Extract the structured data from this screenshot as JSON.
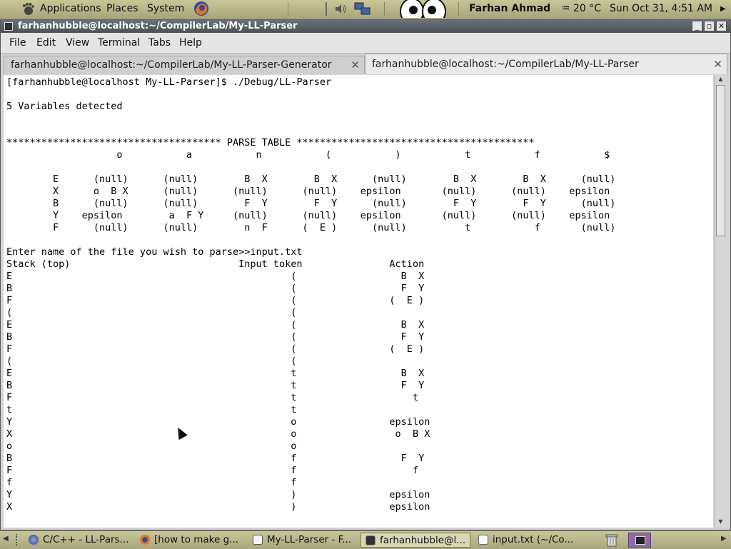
{
  "top_panel": {
    "applications": "Applications",
    "places": "Places",
    "system": "System",
    "user": "Farhan Ahmad",
    "weather": "20 °C",
    "datetime": "Sun Oct 31,  4:51 AM"
  },
  "window": {
    "title": "farhanhubble@localhost:~/CompilerLab/My-LL-Parser",
    "menu": [
      "File",
      "Edit",
      "View",
      "Terminal",
      "Tabs",
      "Help"
    ],
    "tabs": [
      {
        "label": "farhanhubble@localhost:~/CompilerLab/My-LL-Parser-Generator"
      },
      {
        "label": "farhanhubble@localhost:~/CompilerLab/My-LL-Parser"
      }
    ]
  },
  "terminal": {
    "text": "[farhanhubble@localhost My-LL-Parser]$ ./Debug/LL-Parser\n\n5 Variables detected\n\n\n************************************* PARSE TABLE *****************************************\n                   o           a           n           (           )           t           f           $\n\n        E      (null)      (null)        B  X        B  X      (null)        B  X        B  X      (null)\n        X      o  B X      (null)      (null)      (null)    epsilon       (null)      (null)    epsilon\n        B      (null)      (null)        F  Y        F  Y      (null)        F  Y        F  Y      (null)\n        Y    epsilon        a  F Y     (null)      (null)    epsilon       (null)      (null)    epsilon\n        F      (null)      (null)        n  F      (  E )      (null)          t           f       (null)\n\nEnter name of the file you wish to parse>>input.txt\nStack (top)                             Input token               Action\nE                                                (                  B  X\nB                                                (                  F  Y\nF                                                (                (  E )\n(                                                (\nE                                                (                  B  X\nB                                                (                  F  Y\nF                                                (                (  E )\n(                                                (\nE                                                t                  B  X\nB                                                t                  F  Y\nF                                                t                    t\nt                                                t\nY                                                o                epsilon\nX                                                o                 o  B X\no                                                o\nB                                                f                  F  Y\nF                                                f                    f\nf                                                f\nY                                                )                epsilon\nX                                                )                epsilon"
  },
  "taskbar": [
    {
      "label": "C/C++ - LL-Pars...",
      "icon": "eclipse-icon"
    },
    {
      "label": "[how to make g...",
      "icon": "firefox-icon"
    },
    {
      "label": "My-LL-Parser - F...",
      "icon": "file-manager-icon"
    },
    {
      "label": "farhanhubble@l...",
      "icon": "terminal-icon",
      "active": true
    },
    {
      "label": "input.txt (~/Co...",
      "icon": "text-editor-icon"
    }
  ]
}
